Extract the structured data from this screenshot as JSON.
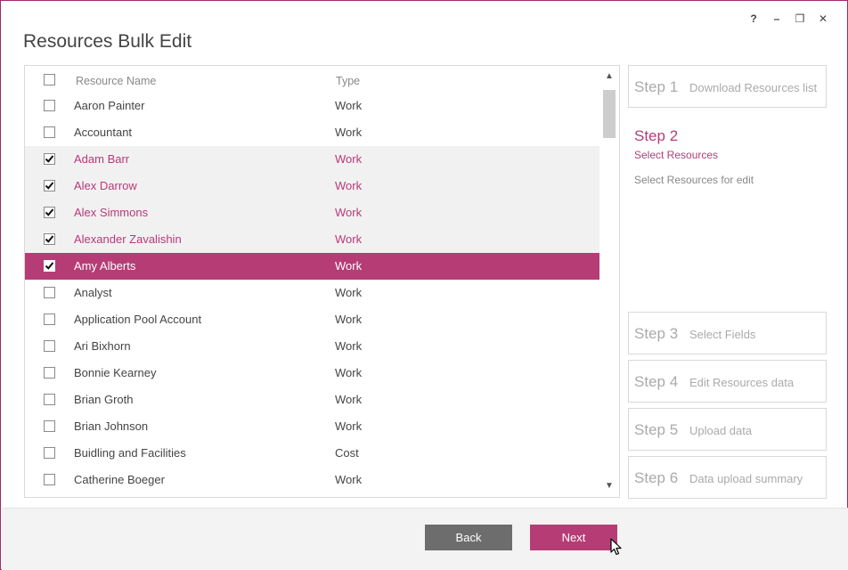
{
  "window": {
    "title": "Resources Bulk Edit",
    "controls": [
      "?",
      "–",
      "❐",
      "✕"
    ]
  },
  "list": {
    "header": {
      "name": "Resource Name",
      "type": "Type"
    },
    "rows": [
      {
        "name": "Aaron Painter",
        "type": "Work",
        "checked": false,
        "selected": false
      },
      {
        "name": "Accountant",
        "type": "Work",
        "checked": false,
        "selected": false
      },
      {
        "name": "Adam Barr",
        "type": "Work",
        "checked": true,
        "selected": false
      },
      {
        "name": "Alex Darrow",
        "type": "Work",
        "checked": true,
        "selected": false
      },
      {
        "name": "Alex Simmons",
        "type": "Work",
        "checked": true,
        "selected": false
      },
      {
        "name": "Alexander Zavalishin",
        "type": "Work",
        "checked": true,
        "selected": false
      },
      {
        "name": "Amy Alberts",
        "type": "Work",
        "checked": true,
        "selected": true
      },
      {
        "name": "Analyst",
        "type": "Work",
        "checked": false,
        "selected": false
      },
      {
        "name": "Application Pool Account",
        "type": "Work",
        "checked": false,
        "selected": false
      },
      {
        "name": "Ari Bixhorn",
        "type": "Work",
        "checked": false,
        "selected": false
      },
      {
        "name": "Bonnie Kearney",
        "type": "Work",
        "checked": false,
        "selected": false
      },
      {
        "name": "Brian Groth",
        "type": "Work",
        "checked": false,
        "selected": false
      },
      {
        "name": "Brian Johnson",
        "type": "Work",
        "checked": false,
        "selected": false
      },
      {
        "name": "Buidling and Facilities",
        "type": "Cost",
        "checked": false,
        "selected": false
      },
      {
        "name": "Catherine Boeger",
        "type": "Work",
        "checked": false,
        "selected": false
      }
    ]
  },
  "steps": {
    "step1": {
      "num": "Step 1",
      "label": "Download Resources list"
    },
    "step2": {
      "num": "Step 2",
      "label": "Select Resources",
      "desc": "Select Resources for edit"
    },
    "step3": {
      "num": "Step 3",
      "label": "Select Fields"
    },
    "step4": {
      "num": "Step 4",
      "label": "Edit Resources data"
    },
    "step5": {
      "num": "Step 5",
      "label": "Upload data"
    },
    "step6": {
      "num": "Step 6",
      "label": "Data upload summary"
    }
  },
  "footer": {
    "back_label": "Back",
    "next_label": "Next"
  },
  "colors": {
    "accent": "#b63c76",
    "back_button": "#6d6d6d",
    "checked_row_bg": "#f1f1f1"
  }
}
